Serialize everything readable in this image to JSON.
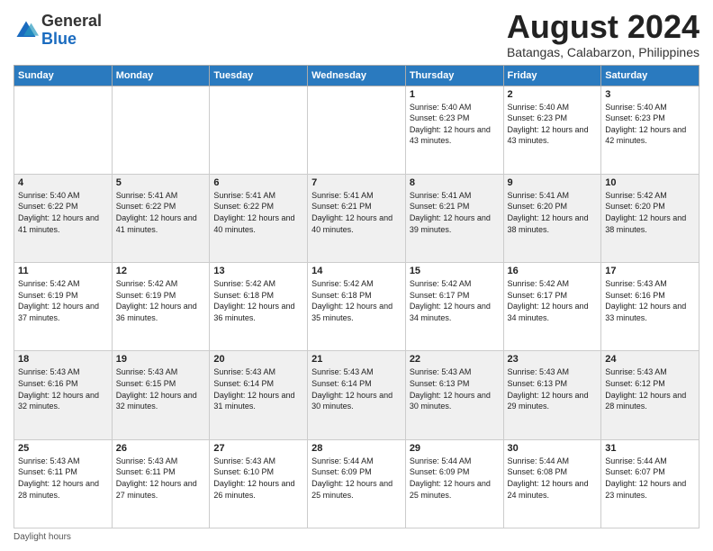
{
  "logo": {
    "general": "General",
    "blue": "Blue"
  },
  "header": {
    "month": "August 2024",
    "location": "Batangas, Calabarzon, Philippines"
  },
  "days_of_week": [
    "Sunday",
    "Monday",
    "Tuesday",
    "Wednesday",
    "Thursday",
    "Friday",
    "Saturday"
  ],
  "footer": {
    "daylight_label": "Daylight hours"
  },
  "weeks": [
    [
      {
        "day": "",
        "sunrise": "",
        "sunset": "",
        "daylight": ""
      },
      {
        "day": "",
        "sunrise": "",
        "sunset": "",
        "daylight": ""
      },
      {
        "day": "",
        "sunrise": "",
        "sunset": "",
        "daylight": ""
      },
      {
        "day": "",
        "sunrise": "",
        "sunset": "",
        "daylight": ""
      },
      {
        "day": "1",
        "sunrise": "Sunrise: 5:40 AM",
        "sunset": "Sunset: 6:23 PM",
        "daylight": "Daylight: 12 hours and 43 minutes."
      },
      {
        "day": "2",
        "sunrise": "Sunrise: 5:40 AM",
        "sunset": "Sunset: 6:23 PM",
        "daylight": "Daylight: 12 hours and 43 minutes."
      },
      {
        "day": "3",
        "sunrise": "Sunrise: 5:40 AM",
        "sunset": "Sunset: 6:23 PM",
        "daylight": "Daylight: 12 hours and 42 minutes."
      }
    ],
    [
      {
        "day": "4",
        "sunrise": "Sunrise: 5:40 AM",
        "sunset": "Sunset: 6:22 PM",
        "daylight": "Daylight: 12 hours and 41 minutes."
      },
      {
        "day": "5",
        "sunrise": "Sunrise: 5:41 AM",
        "sunset": "Sunset: 6:22 PM",
        "daylight": "Daylight: 12 hours and 41 minutes."
      },
      {
        "day": "6",
        "sunrise": "Sunrise: 5:41 AM",
        "sunset": "Sunset: 6:22 PM",
        "daylight": "Daylight: 12 hours and 40 minutes."
      },
      {
        "day": "7",
        "sunrise": "Sunrise: 5:41 AM",
        "sunset": "Sunset: 6:21 PM",
        "daylight": "Daylight: 12 hours and 40 minutes."
      },
      {
        "day": "8",
        "sunrise": "Sunrise: 5:41 AM",
        "sunset": "Sunset: 6:21 PM",
        "daylight": "Daylight: 12 hours and 39 minutes."
      },
      {
        "day": "9",
        "sunrise": "Sunrise: 5:41 AM",
        "sunset": "Sunset: 6:20 PM",
        "daylight": "Daylight: 12 hours and 38 minutes."
      },
      {
        "day": "10",
        "sunrise": "Sunrise: 5:42 AM",
        "sunset": "Sunset: 6:20 PM",
        "daylight": "Daylight: 12 hours and 38 minutes."
      }
    ],
    [
      {
        "day": "11",
        "sunrise": "Sunrise: 5:42 AM",
        "sunset": "Sunset: 6:19 PM",
        "daylight": "Daylight: 12 hours and 37 minutes."
      },
      {
        "day": "12",
        "sunrise": "Sunrise: 5:42 AM",
        "sunset": "Sunset: 6:19 PM",
        "daylight": "Daylight: 12 hours and 36 minutes."
      },
      {
        "day": "13",
        "sunrise": "Sunrise: 5:42 AM",
        "sunset": "Sunset: 6:18 PM",
        "daylight": "Daylight: 12 hours and 36 minutes."
      },
      {
        "day": "14",
        "sunrise": "Sunrise: 5:42 AM",
        "sunset": "Sunset: 6:18 PM",
        "daylight": "Daylight: 12 hours and 35 minutes."
      },
      {
        "day": "15",
        "sunrise": "Sunrise: 5:42 AM",
        "sunset": "Sunset: 6:17 PM",
        "daylight": "Daylight: 12 hours and 34 minutes."
      },
      {
        "day": "16",
        "sunrise": "Sunrise: 5:42 AM",
        "sunset": "Sunset: 6:17 PM",
        "daylight": "Daylight: 12 hours and 34 minutes."
      },
      {
        "day": "17",
        "sunrise": "Sunrise: 5:43 AM",
        "sunset": "Sunset: 6:16 PM",
        "daylight": "Daylight: 12 hours and 33 minutes."
      }
    ],
    [
      {
        "day": "18",
        "sunrise": "Sunrise: 5:43 AM",
        "sunset": "Sunset: 6:16 PM",
        "daylight": "Daylight: 12 hours and 32 minutes."
      },
      {
        "day": "19",
        "sunrise": "Sunrise: 5:43 AM",
        "sunset": "Sunset: 6:15 PM",
        "daylight": "Daylight: 12 hours and 32 minutes."
      },
      {
        "day": "20",
        "sunrise": "Sunrise: 5:43 AM",
        "sunset": "Sunset: 6:14 PM",
        "daylight": "Daylight: 12 hours and 31 minutes."
      },
      {
        "day": "21",
        "sunrise": "Sunrise: 5:43 AM",
        "sunset": "Sunset: 6:14 PM",
        "daylight": "Daylight: 12 hours and 30 minutes."
      },
      {
        "day": "22",
        "sunrise": "Sunrise: 5:43 AM",
        "sunset": "Sunset: 6:13 PM",
        "daylight": "Daylight: 12 hours and 30 minutes."
      },
      {
        "day": "23",
        "sunrise": "Sunrise: 5:43 AM",
        "sunset": "Sunset: 6:13 PM",
        "daylight": "Daylight: 12 hours and 29 minutes."
      },
      {
        "day": "24",
        "sunrise": "Sunrise: 5:43 AM",
        "sunset": "Sunset: 6:12 PM",
        "daylight": "Daylight: 12 hours and 28 minutes."
      }
    ],
    [
      {
        "day": "25",
        "sunrise": "Sunrise: 5:43 AM",
        "sunset": "Sunset: 6:11 PM",
        "daylight": "Daylight: 12 hours and 28 minutes."
      },
      {
        "day": "26",
        "sunrise": "Sunrise: 5:43 AM",
        "sunset": "Sunset: 6:11 PM",
        "daylight": "Daylight: 12 hours and 27 minutes."
      },
      {
        "day": "27",
        "sunrise": "Sunrise: 5:43 AM",
        "sunset": "Sunset: 6:10 PM",
        "daylight": "Daylight: 12 hours and 26 minutes."
      },
      {
        "day": "28",
        "sunrise": "Sunrise: 5:44 AM",
        "sunset": "Sunset: 6:09 PM",
        "daylight": "Daylight: 12 hours and 25 minutes."
      },
      {
        "day": "29",
        "sunrise": "Sunrise: 5:44 AM",
        "sunset": "Sunset: 6:09 PM",
        "daylight": "Daylight: 12 hours and 25 minutes."
      },
      {
        "day": "30",
        "sunrise": "Sunrise: 5:44 AM",
        "sunset": "Sunset: 6:08 PM",
        "daylight": "Daylight: 12 hours and 24 minutes."
      },
      {
        "day": "31",
        "sunrise": "Sunrise: 5:44 AM",
        "sunset": "Sunset: 6:07 PM",
        "daylight": "Daylight: 12 hours and 23 minutes."
      }
    ]
  ]
}
